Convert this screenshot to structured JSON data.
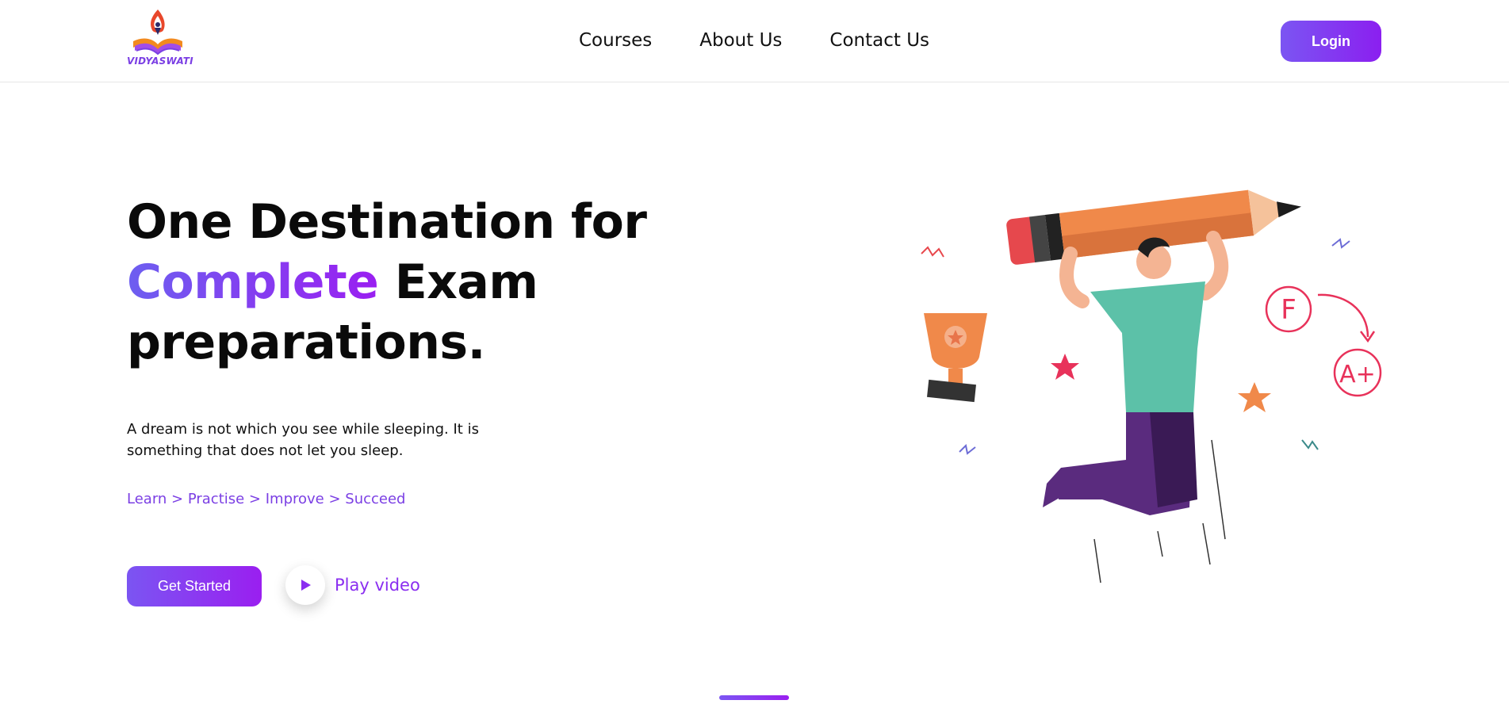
{
  "header": {
    "logo_text": "VIDYASWATI",
    "nav": [
      "Courses",
      "About Us",
      "Contact Us"
    ],
    "login_label": "Login"
  },
  "hero": {
    "headline_line1": "One Destination for",
    "headline_accent": "Complete",
    "headline_line2_rest": " Exam",
    "headline_line3": "preparations.",
    "subtext": "A dream is not which you see while sleeping. It is something that does not let you sleep.",
    "tagline": "Learn > Practise > Improve > Succeed",
    "cta_label": "Get Started",
    "play_label": "Play video"
  },
  "illustration": {
    "grade_before": "F",
    "grade_after": "A+"
  },
  "colors": {
    "accent_start": "#7b55f2",
    "accent_end": "#9a1ff0",
    "text": "#0a0a0a"
  }
}
